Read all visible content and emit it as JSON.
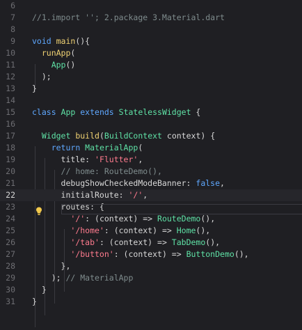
{
  "editor": {
    "lines": [
      {
        "num": "6",
        "tokens": []
      },
      {
        "num": "7",
        "tokens": [
          {
            "t": "//1.import ''; 2.package 3.Material.dart",
            "c": "com"
          }
        ]
      },
      {
        "num": "8",
        "tokens": []
      },
      {
        "num": "9",
        "tokens": [
          {
            "t": "void ",
            "c": "kw"
          },
          {
            "t": "main",
            "c": "fn"
          },
          {
            "t": "(){",
            "c": "txt"
          }
        ]
      },
      {
        "num": "10",
        "tokens": [
          {
            "t": "  ",
            "c": "txt"
          },
          {
            "t": "runApp",
            "c": "fn"
          },
          {
            "t": "(",
            "c": "txt"
          }
        ]
      },
      {
        "num": "11",
        "tokens": [
          {
            "t": "    ",
            "c": "txt"
          },
          {
            "t": "App",
            "c": "cls"
          },
          {
            "t": "()",
            "c": "txt"
          }
        ]
      },
      {
        "num": "12",
        "tokens": [
          {
            "t": "  );",
            "c": "txt"
          }
        ]
      },
      {
        "num": "13",
        "tokens": [
          {
            "t": "}",
            "c": "txt"
          }
        ]
      },
      {
        "num": "14",
        "tokens": []
      },
      {
        "num": "15",
        "tokens": [
          {
            "t": "class ",
            "c": "kw"
          },
          {
            "t": "App ",
            "c": "cls"
          },
          {
            "t": "extends ",
            "c": "kw"
          },
          {
            "t": "StatelessWidget",
            "c": "cls"
          },
          {
            "t": " {",
            "c": "txt"
          }
        ]
      },
      {
        "num": "16",
        "tokens": []
      },
      {
        "num": "17",
        "tokens": [
          {
            "t": "  ",
            "c": "txt"
          },
          {
            "t": "Widget ",
            "c": "cls"
          },
          {
            "t": "build",
            "c": "fn"
          },
          {
            "t": "(",
            "c": "txt"
          },
          {
            "t": "BuildContext ",
            "c": "cls"
          },
          {
            "t": "context) {",
            "c": "txt"
          }
        ]
      },
      {
        "num": "18",
        "tokens": [
          {
            "t": "    ",
            "c": "txt"
          },
          {
            "t": "return ",
            "c": "kw"
          },
          {
            "t": "MaterialApp",
            "c": "cls"
          },
          {
            "t": "(",
            "c": "txt"
          }
        ]
      },
      {
        "num": "19",
        "tokens": [
          {
            "t": "      title: ",
            "c": "txt"
          },
          {
            "t": "'Flutter'",
            "c": "str"
          },
          {
            "t": ",",
            "c": "txt"
          }
        ]
      },
      {
        "num": "20",
        "tokens": [
          {
            "t": "      ",
            "c": "txt"
          },
          {
            "t": "// home: RouteDemo(),",
            "c": "com"
          }
        ]
      },
      {
        "num": "21",
        "tokens": [
          {
            "t": "      debugShowCheckedModeBanner: ",
            "c": "txt"
          },
          {
            "t": "false",
            "c": "kw"
          },
          {
            "t": ",",
            "c": "txt"
          }
        ]
      },
      {
        "num": "22",
        "tokens": [
          {
            "t": "      initialRoute: ",
            "c": "txt"
          },
          {
            "t": "'/'",
            "c": "str"
          },
          {
            "t": ",",
            "c": "txt"
          }
        ],
        "active": true
      },
      {
        "num": "23",
        "tokens": [
          {
            "t": "      routes: {",
            "c": "txt"
          }
        ]
      },
      {
        "num": "24",
        "tokens": [
          {
            "t": "        ",
            "c": "txt"
          },
          {
            "t": "'/'",
            "c": "str"
          },
          {
            "t": ": (context) => ",
            "c": "txt"
          },
          {
            "t": "RouteDemo",
            "c": "cls"
          },
          {
            "t": "(),",
            "c": "txt"
          }
        ]
      },
      {
        "num": "25",
        "tokens": [
          {
            "t": "        ",
            "c": "txt"
          },
          {
            "t": "'/home'",
            "c": "str"
          },
          {
            "t": ": (context) => ",
            "c": "txt"
          },
          {
            "t": "Home",
            "c": "cls"
          },
          {
            "t": "(),",
            "c": "txt"
          }
        ]
      },
      {
        "num": "26",
        "tokens": [
          {
            "t": "        ",
            "c": "txt"
          },
          {
            "t": "'/tab'",
            "c": "str"
          },
          {
            "t": ": (context) => ",
            "c": "txt"
          },
          {
            "t": "TabDemo",
            "c": "cls"
          },
          {
            "t": "(),",
            "c": "txt"
          }
        ]
      },
      {
        "num": "27",
        "tokens": [
          {
            "t": "        ",
            "c": "txt"
          },
          {
            "t": "'/button'",
            "c": "str"
          },
          {
            "t": ": (context) => ",
            "c": "txt"
          },
          {
            "t": "ButtonDemo",
            "c": "cls"
          },
          {
            "t": "(),",
            "c": "txt"
          }
        ]
      },
      {
        "num": "28",
        "tokens": [
          {
            "t": "      },",
            "c": "txt"
          }
        ]
      },
      {
        "num": "29",
        "tokens": [
          {
            "t": "    ); ",
            "c": "txt"
          },
          {
            "t": "// MaterialApp",
            "c": "com"
          }
        ]
      },
      {
        "num": "30",
        "tokens": [
          {
            "t": "  }",
            "c": "txt"
          }
        ]
      },
      {
        "num": "31",
        "tokens": [
          {
            "t": "}",
            "c": "txt"
          }
        ]
      }
    ],
    "gutter_hint": "lightbulb-icon"
  }
}
